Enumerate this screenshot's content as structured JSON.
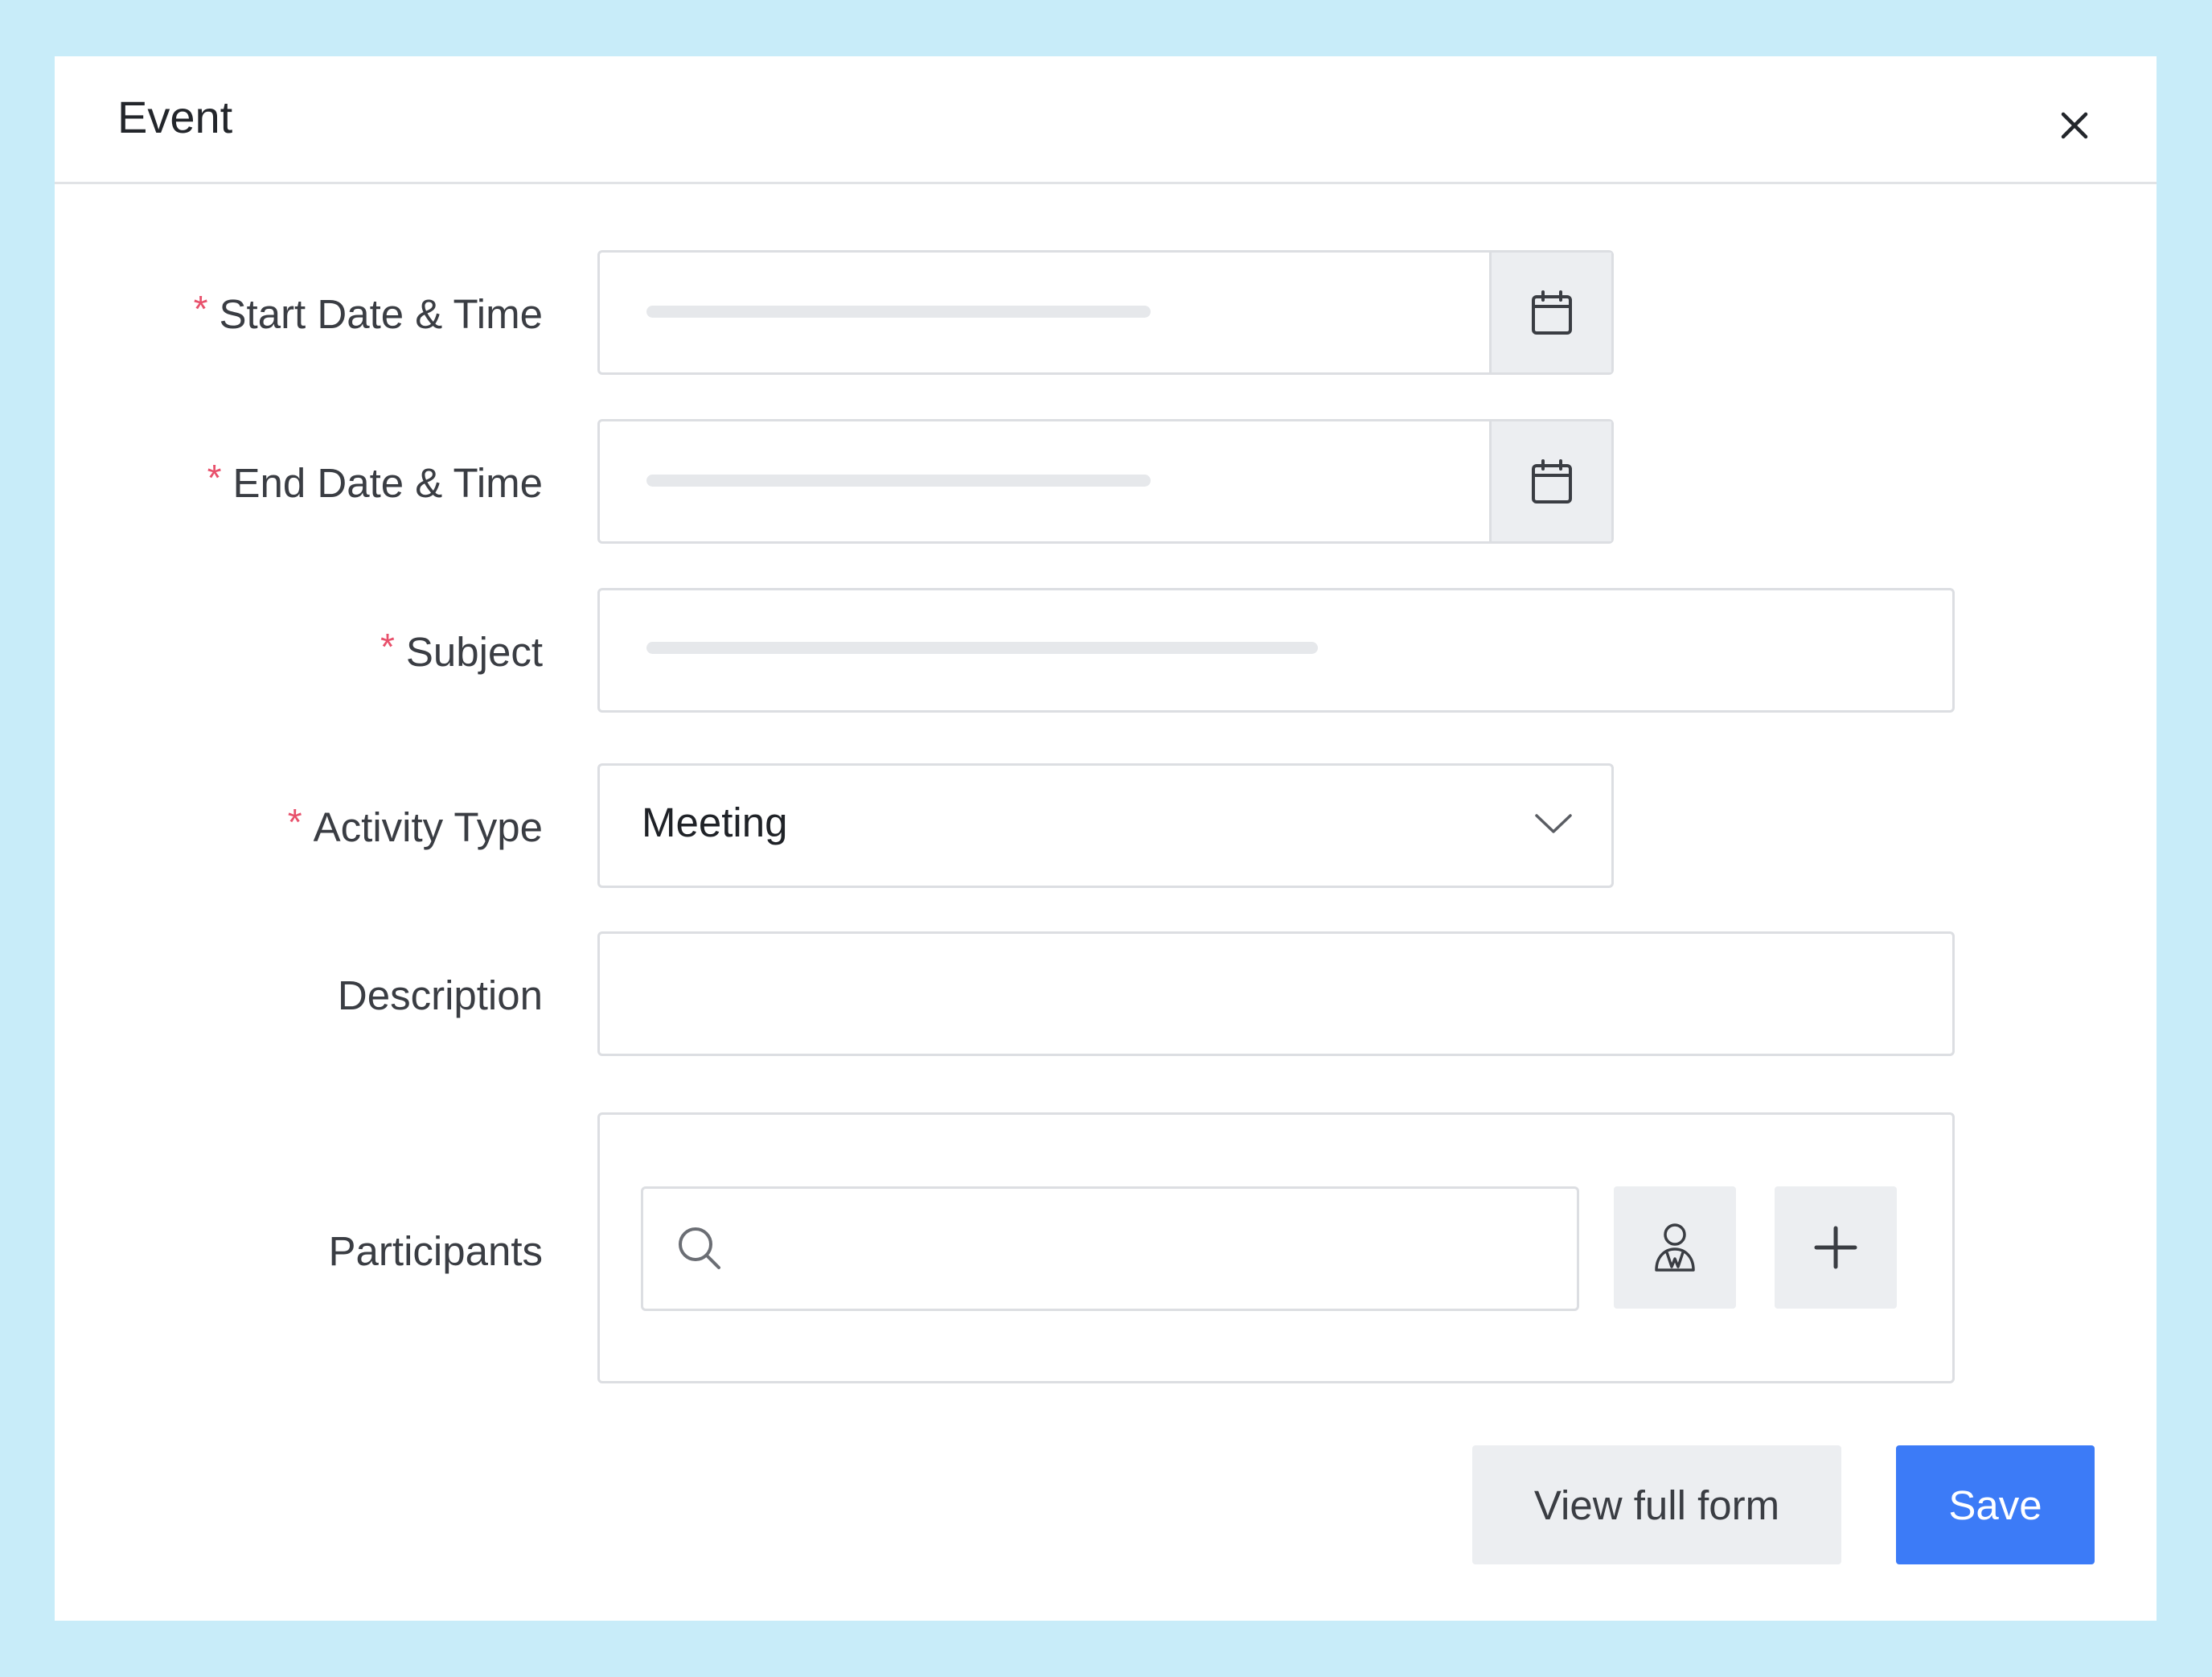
{
  "dialog": {
    "title": "Event",
    "close_icon": "close-icon"
  },
  "form": {
    "required_marker": "*",
    "start_datetime": {
      "label": "Start Date & Time",
      "icon": "calendar-icon"
    },
    "end_datetime": {
      "label": "End Date & Time",
      "icon": "calendar-icon"
    },
    "subject": {
      "label": "Subject"
    },
    "activity_type": {
      "label": "Activity Type",
      "value": "Meeting",
      "icon": "chevron-down-icon"
    },
    "description": {
      "label": "Description"
    },
    "participants": {
      "label": "Participants",
      "search_icon": "search-icon",
      "user_icon": "contact-person-icon",
      "add_icon": "plus-icon"
    }
  },
  "footer": {
    "view_full_form_label": "View full form",
    "save_label": "Save"
  },
  "colors": {
    "background": "#c8ecf9",
    "primary": "#3c7bf7",
    "required": "#e8506b"
  }
}
